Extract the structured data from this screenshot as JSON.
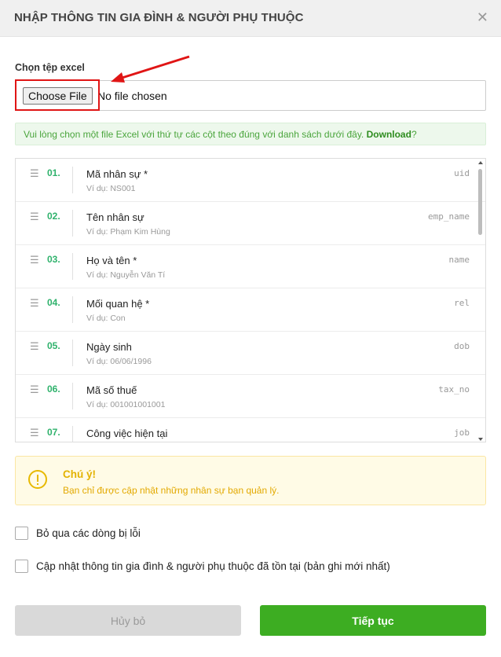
{
  "dialog": {
    "title": "NHẬP THÔNG TIN GIA ĐÌNH & NGƯỜI PHỤ THUỘC",
    "close_icon": "close-icon"
  },
  "file": {
    "label": "Chọn tệp excel",
    "button": "Choose File",
    "status": "No file chosen"
  },
  "info": {
    "text": "Vui lòng chọn một file Excel với thứ tự các cột theo đúng với danh sách dưới đây.",
    "link": "Download",
    "suffix": "?"
  },
  "fields": [
    {
      "num": "01.",
      "name": "Mã nhân sự *",
      "example": "Ví dụ: NS001",
      "code": "uid"
    },
    {
      "num": "02.",
      "name": "Tên nhân sự",
      "example": "Ví dụ: Phạm Kim Hùng",
      "code": "emp_name"
    },
    {
      "num": "03.",
      "name": "Họ và tên *",
      "example": "Ví dụ: Nguyễn Văn Tí",
      "code": "name"
    },
    {
      "num": "04.",
      "name": "Mối quan hệ *",
      "example": "Ví dụ: Con",
      "code": "rel"
    },
    {
      "num": "05.",
      "name": "Ngày sinh",
      "example": "Ví dụ: 06/06/1996",
      "code": "dob"
    },
    {
      "num": "06.",
      "name": "Mã số thuế",
      "example": "Ví dụ: 001001001001",
      "code": "tax_no"
    },
    {
      "num": "07.",
      "name": "Công việc hiện tại",
      "example": "",
      "code": "job"
    }
  ],
  "warning": {
    "title": "Chú ý!",
    "text": "Bạn chỉ được cập nhật những nhân sự bạn quản lý."
  },
  "options": {
    "skip_errors": "Bỏ qua các dòng bị lỗi",
    "update_existing": "Cập nhật thông tin gia đình & người phụ thuộc đã tồn tại (bản ghi mới nhất)"
  },
  "buttons": {
    "cancel": "Hủy bỏ",
    "next": "Tiếp tục"
  },
  "colors": {
    "primary": "#3dad22",
    "highlight": "#e01515",
    "warning": "#e3b200"
  }
}
